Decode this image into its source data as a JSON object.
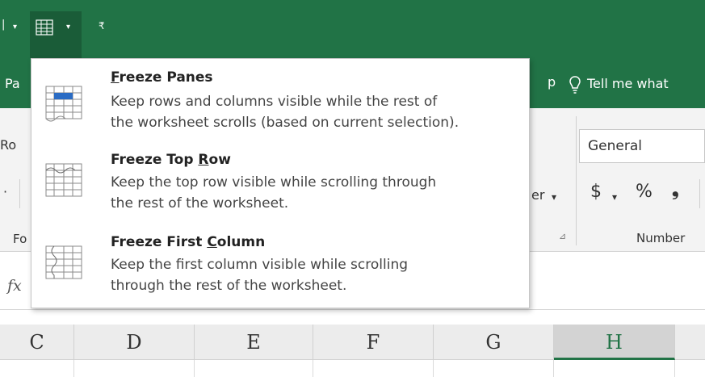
{
  "quick_access": {
    "dropdown_arrow": "▾",
    "customize_glyph": "₹",
    "freeze_button_icon": "freeze-panes-icon"
  },
  "tabs": {
    "left_partial": "Pa",
    "mid_partial": "p",
    "tell_me": "Tell me what"
  },
  "ribbon": {
    "row1_left_partial": "Ro",
    "row2_left_partial": "·",
    "wrap_partial": "er",
    "wrap_arrow": "▾",
    "number_format_value": "General",
    "currency_symbol": "$",
    "currency_arrow": "▾",
    "percent_symbol": "%",
    "comma_symbol": "❟",
    "font_group_partial": "Fo",
    "alignment_launcher": "⊿",
    "number_group_label": "Number"
  },
  "formula_bar": {
    "fx_label": "fx"
  },
  "columns": [
    "C",
    "D",
    "E",
    "F",
    "G",
    "H"
  ],
  "selected_column": "H",
  "menu": {
    "items": [
      {
        "title_pre": "",
        "title_key": "F",
        "title_post": "reeze Panes",
        "desc_line1": "Keep rows and columns visible while the rest of",
        "desc_line2": "the worksheet scrolls (based on current selection).",
        "icon": "freeze-panes-icon"
      },
      {
        "title_pre": "Freeze Top ",
        "title_key": "R",
        "title_post": "ow",
        "desc_line1": "Keep the top row visible while scrolling through",
        "desc_line2": "the rest of the worksheet.",
        "icon": "freeze-top-row-icon"
      },
      {
        "title_pre": "Freeze First ",
        "title_key": "C",
        "title_post": "olumn",
        "desc_line1": "Keep the first column visible while scrolling",
        "desc_line2": "through the rest of the worksheet.",
        "icon": "freeze-first-column-icon"
      }
    ]
  },
  "colors": {
    "excel_green": "#217346",
    "selection_blue": "#2b6cc4"
  }
}
